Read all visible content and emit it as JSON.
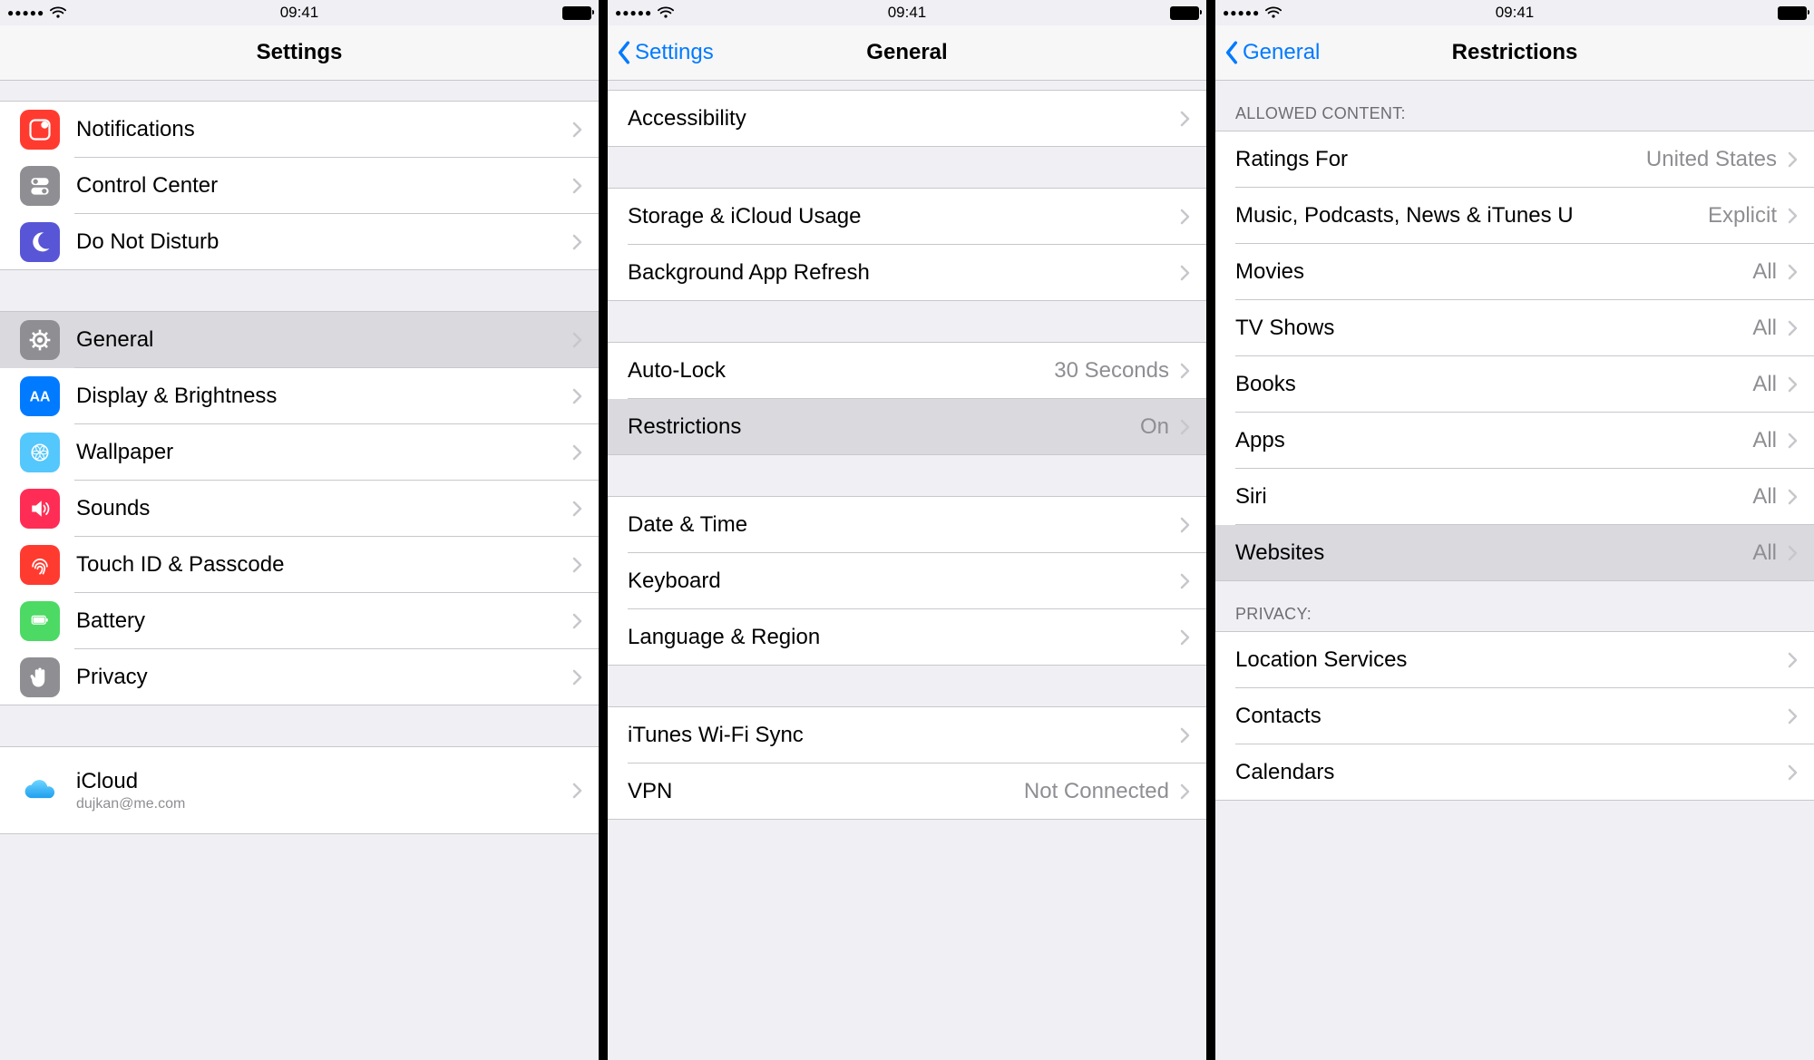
{
  "statusbar": {
    "time": "09:41"
  },
  "screen1": {
    "title": "Settings",
    "groups": [
      {
        "spacer_before": "mini",
        "rows": [
          {
            "key": "notifications",
            "label": "Notifications",
            "icon": "notifications-icon",
            "icon_bg": "#ff3b30"
          },
          {
            "key": "control-center",
            "label": "Control Center",
            "icon": "control-center-icon",
            "icon_bg": "#8e8e93"
          },
          {
            "key": "do-not-disturb",
            "label": "Do Not Disturb",
            "icon": "moon-icon",
            "icon_bg": "#5856d6"
          }
        ]
      },
      {
        "rows": [
          {
            "key": "general",
            "label": "General",
            "icon": "gear-icon",
            "icon_bg": "#8e8e93",
            "highlighted": true
          },
          {
            "key": "display-brightness",
            "label": "Display & Brightness",
            "icon": "display-brightness-icon",
            "icon_bg": "#007aff"
          },
          {
            "key": "wallpaper",
            "label": "Wallpaper",
            "icon": "wallpaper-icon",
            "icon_bg": "#54c7fc"
          },
          {
            "key": "sounds",
            "label": "Sounds",
            "icon": "speaker-icon",
            "icon_bg": "#ff2d55"
          },
          {
            "key": "touch-id-passcode",
            "label": "Touch ID & Passcode",
            "icon": "fingerprint-icon",
            "icon_bg": "#ff3b30"
          },
          {
            "key": "battery",
            "label": "Battery",
            "icon": "battery-settings-icon",
            "icon_bg": "#4cd964"
          },
          {
            "key": "privacy",
            "label": "Privacy",
            "icon": "hand-icon",
            "icon_bg": "#8e8e93"
          }
        ]
      },
      {
        "rows": [
          {
            "key": "icloud",
            "label": "iCloud",
            "subtitle": "dujkan@me.com",
            "icon": "cloud-icon",
            "icon_bg": "#ffffff",
            "tall": true
          }
        ]
      }
    ]
  },
  "screen2": {
    "title": "General",
    "back_label": "Settings",
    "groups": [
      {
        "spacer_before": "tiny",
        "rows": [
          {
            "key": "accessibility",
            "label": "Accessibility"
          }
        ]
      },
      {
        "rows": [
          {
            "key": "storage-icloud",
            "label": "Storage & iCloud Usage"
          },
          {
            "key": "background-app-refresh",
            "label": "Background App Refresh"
          }
        ]
      },
      {
        "rows": [
          {
            "key": "auto-lock",
            "label": "Auto-Lock",
            "detail": "30 Seconds"
          },
          {
            "key": "restrictions",
            "label": "Restrictions",
            "detail": "On",
            "highlighted": true
          }
        ]
      },
      {
        "rows": [
          {
            "key": "date-time",
            "label": "Date & Time"
          },
          {
            "key": "keyboard",
            "label": "Keyboard"
          },
          {
            "key": "language-region",
            "label": "Language & Region"
          }
        ]
      },
      {
        "rows": [
          {
            "key": "itunes-wifi-sync",
            "label": "iTunes Wi-Fi Sync"
          },
          {
            "key": "vpn",
            "label": "VPN",
            "detail": "Not Connected"
          }
        ]
      }
    ]
  },
  "screen3": {
    "title": "Restrictions",
    "back_label": "General",
    "groups": [
      {
        "header": "Allowed Content:",
        "rows": [
          {
            "key": "ratings-for",
            "label": "Ratings For",
            "detail": "United States"
          },
          {
            "key": "music-podcasts",
            "label": "Music, Podcasts, News & iTunes U",
            "detail": "Explicit"
          },
          {
            "key": "movies",
            "label": "Movies",
            "detail": "All"
          },
          {
            "key": "tv-shows",
            "label": "TV Shows",
            "detail": "All"
          },
          {
            "key": "books",
            "label": "Books",
            "detail": "All"
          },
          {
            "key": "apps",
            "label": "Apps",
            "detail": "All"
          },
          {
            "key": "siri",
            "label": "Siri",
            "detail": "All"
          },
          {
            "key": "websites",
            "label": "Websites",
            "detail": "All",
            "highlighted": true
          }
        ]
      },
      {
        "header": "Privacy:",
        "rows": [
          {
            "key": "location-services",
            "label": "Location Services"
          },
          {
            "key": "contacts",
            "label": "Contacts"
          },
          {
            "key": "calendars",
            "label": "Calendars"
          }
        ]
      }
    ]
  }
}
